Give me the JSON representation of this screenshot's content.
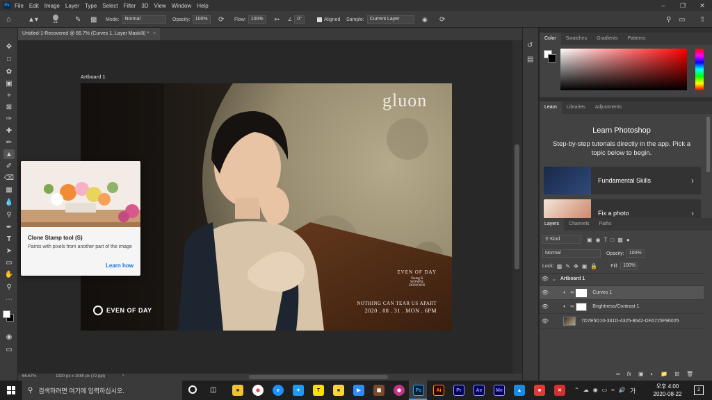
{
  "app": {
    "logo": "Ps"
  },
  "menu": [
    "File",
    "Edit",
    "Image",
    "Layer",
    "Type",
    "Select",
    "Filter",
    "3D",
    "View",
    "Window",
    "Help"
  ],
  "options": {
    "brush_size": "21",
    "mode_label": "Mode:",
    "mode_value": "Normal",
    "opacity_label": "Opacity:",
    "opacity_value": "100%",
    "flow_label": "Flow:",
    "flow_value": "100%",
    "angle_value": "0°",
    "aligned_label": "Aligned",
    "sample_label": "Sample:",
    "sample_value": "Current Layer"
  },
  "document": {
    "tab_title": "Untitled-1-Recovered @ 66.7% (Curves 1, Layer Mask/8) *",
    "close_glyph": "×",
    "artboard_label": "Artboard 1",
    "zoom": "66.67%",
    "doc_size": "1920 px x 1080 px (72 ppi)"
  },
  "artwork": {
    "brand": "gluon",
    "credits_title": "EVEN OF DAY",
    "credits": [
      "Young K",
      "WONPIL",
      "DOWOON"
    ],
    "tagline": "NOTHING CAN TEAR US APART",
    "date": "2020 . 08 . 31 . MON . 6PM",
    "logo_text": "EVEN OF DAY"
  },
  "tooltip": {
    "title": "Clone Stamp tool (S)",
    "description": "Paints with pixels from another part of the image",
    "link": "Learn how"
  },
  "color_panel": {
    "tabs": [
      "Color",
      "Swatches",
      "Gradients",
      "Patterns"
    ]
  },
  "learn_panel": {
    "tabs": [
      "Learn",
      "Libraries",
      "Adjustments"
    ],
    "heading": "Learn Photoshop",
    "body": "Step-by-step tutorials directly in the app. Pick a topic below to begin.",
    "cards": [
      "Fundamental Skills",
      "Fix a photo"
    ]
  },
  "layers_panel": {
    "tabs": [
      "Layers",
      "Channels",
      "Paths"
    ],
    "filter_kind": "Kind",
    "blend_mode": "Normal",
    "opacity_label": "Opacity:",
    "opacity_value": "100%",
    "lock_label": "Lock:",
    "fill_label": "Fill:",
    "fill_value": "100%",
    "layers": [
      {
        "name": "Artboard 1"
      },
      {
        "name": "Curves 1"
      },
      {
        "name": "Brightness/Contrast 1"
      },
      {
        "name": "7D7E5D10-331D-4325-8642-DFA725F96025"
      }
    ],
    "footer_fx": "fx"
  },
  "taskbar": {
    "search_placeholder": "검색하려면 여기에 입력하십시오.",
    "time_prefix": "오후",
    "time": "4:00",
    "date": "2020-08-22",
    "notification_count": "2",
    "apps": [
      {
        "label": "Ps",
        "bg": "#001e36",
        "fg": "#31a8ff"
      },
      {
        "label": "Ai",
        "bg": "#330000",
        "fg": "#ff9a00"
      },
      {
        "label": "Pr",
        "bg": "#00005b",
        "fg": "#9999ff"
      },
      {
        "label": "Ae",
        "bg": "#00005b",
        "fg": "#9999ff"
      },
      {
        "label": "Me",
        "bg": "#00005b",
        "fg": "#9999ff"
      }
    ]
  },
  "colors": {
    "accent": "#31a8ff",
    "link": "#1473e6",
    "panel": "#424242",
    "canvas": "#282828"
  }
}
